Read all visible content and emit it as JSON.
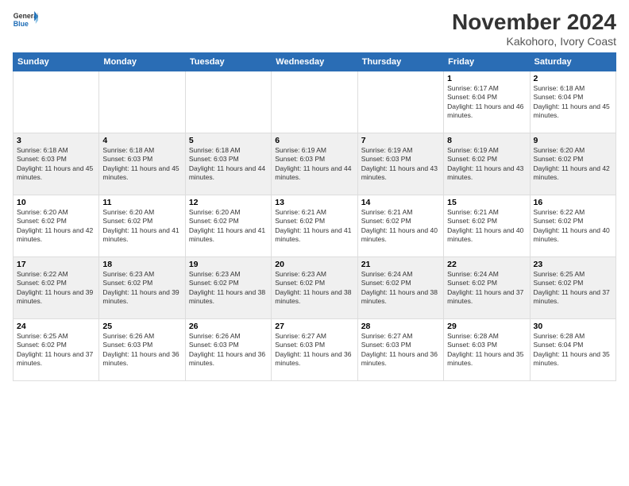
{
  "logo": {
    "line1": "General",
    "line2": "Blue"
  },
  "title": "November 2024",
  "subtitle": "Kakohoro, Ivory Coast",
  "days_header": [
    "Sunday",
    "Monday",
    "Tuesday",
    "Wednesday",
    "Thursday",
    "Friday",
    "Saturday"
  ],
  "weeks": [
    [
      {
        "day": "",
        "info": ""
      },
      {
        "day": "",
        "info": ""
      },
      {
        "day": "",
        "info": ""
      },
      {
        "day": "",
        "info": ""
      },
      {
        "day": "",
        "info": ""
      },
      {
        "day": "1",
        "info": "Sunrise: 6:17 AM\nSunset: 6:04 PM\nDaylight: 11 hours and 46 minutes."
      },
      {
        "day": "2",
        "info": "Sunrise: 6:18 AM\nSunset: 6:04 PM\nDaylight: 11 hours and 45 minutes."
      }
    ],
    [
      {
        "day": "3",
        "info": "Sunrise: 6:18 AM\nSunset: 6:03 PM\nDaylight: 11 hours and 45 minutes."
      },
      {
        "day": "4",
        "info": "Sunrise: 6:18 AM\nSunset: 6:03 PM\nDaylight: 11 hours and 45 minutes."
      },
      {
        "day": "5",
        "info": "Sunrise: 6:18 AM\nSunset: 6:03 PM\nDaylight: 11 hours and 44 minutes."
      },
      {
        "day": "6",
        "info": "Sunrise: 6:19 AM\nSunset: 6:03 PM\nDaylight: 11 hours and 44 minutes."
      },
      {
        "day": "7",
        "info": "Sunrise: 6:19 AM\nSunset: 6:03 PM\nDaylight: 11 hours and 43 minutes."
      },
      {
        "day": "8",
        "info": "Sunrise: 6:19 AM\nSunset: 6:02 PM\nDaylight: 11 hours and 43 minutes."
      },
      {
        "day": "9",
        "info": "Sunrise: 6:20 AM\nSunset: 6:02 PM\nDaylight: 11 hours and 42 minutes."
      }
    ],
    [
      {
        "day": "10",
        "info": "Sunrise: 6:20 AM\nSunset: 6:02 PM\nDaylight: 11 hours and 42 minutes."
      },
      {
        "day": "11",
        "info": "Sunrise: 6:20 AM\nSunset: 6:02 PM\nDaylight: 11 hours and 41 minutes."
      },
      {
        "day": "12",
        "info": "Sunrise: 6:20 AM\nSunset: 6:02 PM\nDaylight: 11 hours and 41 minutes."
      },
      {
        "day": "13",
        "info": "Sunrise: 6:21 AM\nSunset: 6:02 PM\nDaylight: 11 hours and 41 minutes."
      },
      {
        "day": "14",
        "info": "Sunrise: 6:21 AM\nSunset: 6:02 PM\nDaylight: 11 hours and 40 minutes."
      },
      {
        "day": "15",
        "info": "Sunrise: 6:21 AM\nSunset: 6:02 PM\nDaylight: 11 hours and 40 minutes."
      },
      {
        "day": "16",
        "info": "Sunrise: 6:22 AM\nSunset: 6:02 PM\nDaylight: 11 hours and 40 minutes."
      }
    ],
    [
      {
        "day": "17",
        "info": "Sunrise: 6:22 AM\nSunset: 6:02 PM\nDaylight: 11 hours and 39 minutes."
      },
      {
        "day": "18",
        "info": "Sunrise: 6:23 AM\nSunset: 6:02 PM\nDaylight: 11 hours and 39 minutes."
      },
      {
        "day": "19",
        "info": "Sunrise: 6:23 AM\nSunset: 6:02 PM\nDaylight: 11 hours and 38 minutes."
      },
      {
        "day": "20",
        "info": "Sunrise: 6:23 AM\nSunset: 6:02 PM\nDaylight: 11 hours and 38 minutes."
      },
      {
        "day": "21",
        "info": "Sunrise: 6:24 AM\nSunset: 6:02 PM\nDaylight: 11 hours and 38 minutes."
      },
      {
        "day": "22",
        "info": "Sunrise: 6:24 AM\nSunset: 6:02 PM\nDaylight: 11 hours and 37 minutes."
      },
      {
        "day": "23",
        "info": "Sunrise: 6:25 AM\nSunset: 6:02 PM\nDaylight: 11 hours and 37 minutes."
      }
    ],
    [
      {
        "day": "24",
        "info": "Sunrise: 6:25 AM\nSunset: 6:02 PM\nDaylight: 11 hours and 37 minutes."
      },
      {
        "day": "25",
        "info": "Sunrise: 6:26 AM\nSunset: 6:03 PM\nDaylight: 11 hours and 36 minutes."
      },
      {
        "day": "26",
        "info": "Sunrise: 6:26 AM\nSunset: 6:03 PM\nDaylight: 11 hours and 36 minutes."
      },
      {
        "day": "27",
        "info": "Sunrise: 6:27 AM\nSunset: 6:03 PM\nDaylight: 11 hours and 36 minutes."
      },
      {
        "day": "28",
        "info": "Sunrise: 6:27 AM\nSunset: 6:03 PM\nDaylight: 11 hours and 36 minutes."
      },
      {
        "day": "29",
        "info": "Sunrise: 6:28 AM\nSunset: 6:03 PM\nDaylight: 11 hours and 35 minutes."
      },
      {
        "day": "30",
        "info": "Sunrise: 6:28 AM\nSunset: 6:04 PM\nDaylight: 11 hours and 35 minutes."
      }
    ]
  ]
}
